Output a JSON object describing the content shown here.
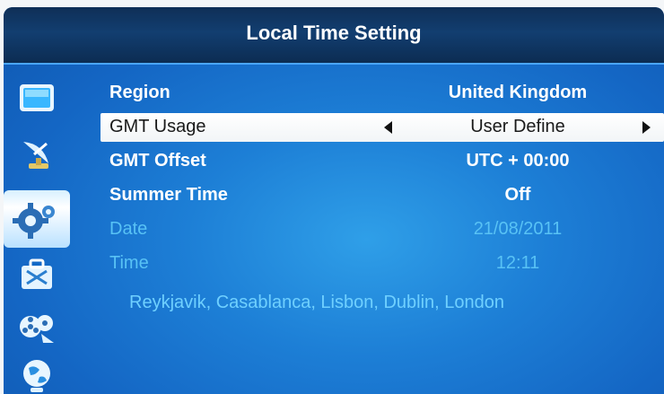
{
  "header": {
    "title": "Local Time Setting"
  },
  "sidebar": {
    "items": [
      {
        "icon": "tv-icon"
      },
      {
        "icon": "satellite-dish-icon"
      },
      {
        "icon": "settings-gear-icon",
        "selected": true
      },
      {
        "icon": "toolbox-icon"
      },
      {
        "icon": "film-reel-icon"
      },
      {
        "icon": "globe-icon"
      }
    ]
  },
  "settings": [
    {
      "label": "Region",
      "value": "United Kingdom"
    },
    {
      "label": "GMT Usage",
      "value": "User Define"
    },
    {
      "label": "GMT Offset",
      "value": "UTC + 00:00"
    },
    {
      "label": "Summer Time",
      "value": "Off"
    },
    {
      "label": "Date",
      "value": "21/08/2011"
    },
    {
      "label": "Time",
      "value": "12:11"
    }
  ],
  "cities": "Reykjavik, Casablanca, Lisbon, Dublin, London",
  "colors": {
    "highlight": "#ffffff",
    "disabled_text": "#58c2f5",
    "background": "#1d7fd6"
  }
}
